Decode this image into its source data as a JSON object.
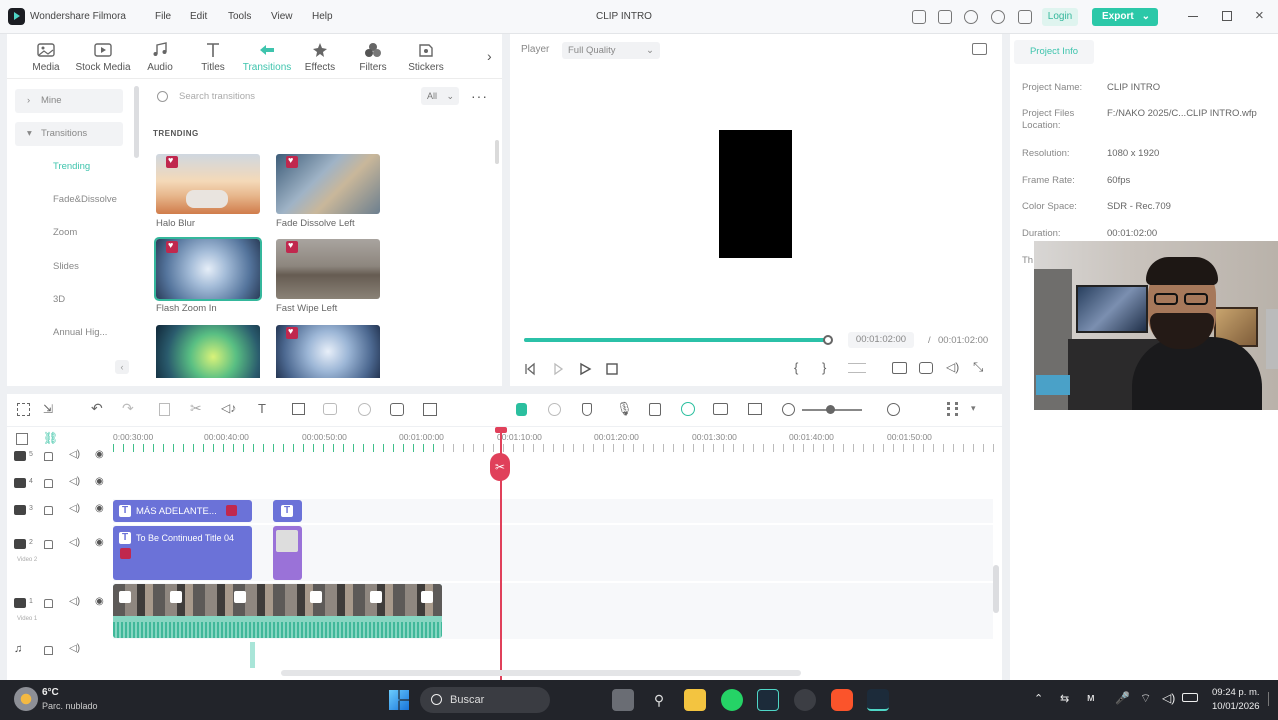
{
  "app": {
    "name": "Wondershare Filmora",
    "project_title": "CLIP INTRO",
    "login": "Login",
    "export": "Export"
  },
  "menu": [
    "File",
    "Edit",
    "Tools",
    "View",
    "Help"
  ],
  "library": {
    "tabs": [
      {
        "label": "Media",
        "icon": "media-icon"
      },
      {
        "label": "Stock Media",
        "icon": "stock-media-icon"
      },
      {
        "label": "Audio",
        "icon": "audio-icon"
      },
      {
        "label": "Titles",
        "icon": "titles-icon"
      },
      {
        "label": "Transitions",
        "icon": "transitions-icon",
        "active": true
      },
      {
        "label": "Effects",
        "icon": "effects-icon"
      },
      {
        "label": "Filters",
        "icon": "filters-icon"
      },
      {
        "label": "Stickers",
        "icon": "stickers-icon"
      }
    ],
    "sidebar": [
      "Mine",
      "Transitions",
      "Trending",
      "Fade&Dissolve",
      "Zoom",
      "Slides",
      "3D",
      "Annual Hig..."
    ],
    "search_placeholder": "Search transitions",
    "filter": "All",
    "section": "TRENDING",
    "items": [
      "Halo Blur",
      "Fade Dissolve Left",
      "Flash Zoom In",
      "Fast Wipe Left"
    ]
  },
  "player": {
    "label": "Player",
    "quality": "Full Quality",
    "current_time": "00:01:02:00",
    "sep": "/",
    "total_time": "00:01:02:00",
    "progress": 1.0
  },
  "project_info": {
    "tab": "Project Info",
    "rows": [
      {
        "key": "Project Name:",
        "value": "CLIP INTRO"
      },
      {
        "key": "Project Files Location:",
        "value": "F:/NAKO 2025/C...CLIP INTRO.wfp"
      },
      {
        "key": "Resolution:",
        "value": "1080 x 1920"
      },
      {
        "key": "Frame Rate:",
        "value": "60fps"
      },
      {
        "key": "Color Space:",
        "value": "SDR - Rec.709"
      },
      {
        "key": "Duration:",
        "value": "00:01:02:00"
      },
      {
        "key": "Th",
        "value": ""
      }
    ]
  },
  "timeline": {
    "ruler": [
      "0:00:30:00",
      "00:00:40:00",
      "00:00:50:00",
      "00:01:00:00",
      "00:01:10:00",
      "00:01:20:00",
      "00:01:30:00",
      "00:01:40:00",
      "00:01:50:00"
    ],
    "track_labels": [
      "5",
      "4",
      "3",
      "2",
      "Video 2",
      "1",
      "Video 1"
    ],
    "clips": [
      "MÁS ADELANTE...",
      "To Be Continued Title 04"
    ]
  },
  "taskbar": {
    "temp": "6°C",
    "weather": "Parc. nublado",
    "search": "Buscar",
    "time": "09:24 p. m.",
    "date": "10/01/2026"
  }
}
